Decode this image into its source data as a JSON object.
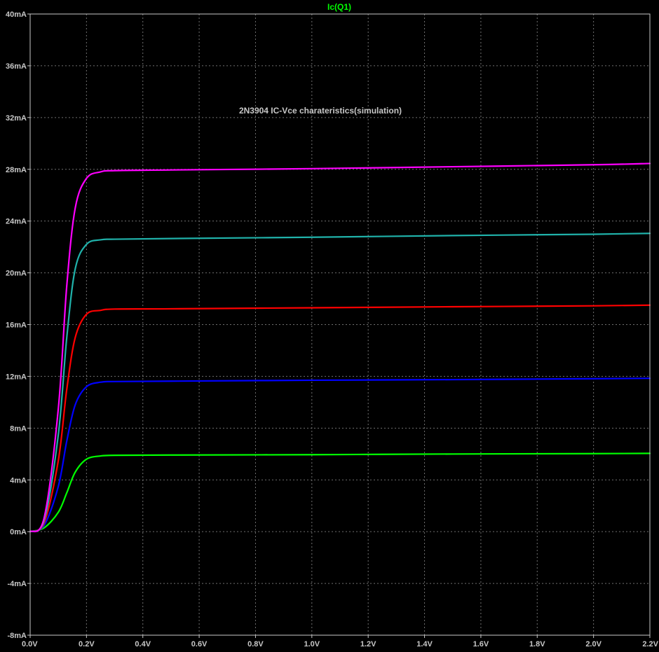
{
  "chart_data": {
    "type": "line",
    "title": "Ic(Q1)",
    "annotation": "2N3904 IC-Vce charateristics(simulation)",
    "xlim": [
      0,
      2.2
    ],
    "ylim": [
      -8,
      40
    ],
    "grid": true,
    "x_ticks": [
      0,
      0.2,
      0.4,
      0.6,
      0.8,
      1.0,
      1.2,
      1.4,
      1.6,
      1.8,
      2.0,
      2.2
    ],
    "x_tick_labels": [
      "0.0V",
      "0.2V",
      "0.4V",
      "0.6V",
      "0.8V",
      "1.0V",
      "1.2V",
      "1.4V",
      "1.6V",
      "1.8V",
      "2.0V",
      "2.2V"
    ],
    "y_ticks": [
      -8,
      -4,
      0,
      4,
      8,
      12,
      16,
      20,
      24,
      28,
      32,
      36,
      40
    ],
    "y_tick_labels": [
      "-8mA",
      "-4mA",
      "0mA",
      "4mA",
      "8mA",
      "12mA",
      "16mA",
      "20mA",
      "24mA",
      "28mA",
      "32mA",
      "36mA",
      "40mA"
    ],
    "colors": {
      "background": "#000000",
      "axis": "#c8c8c8",
      "grid": "#707070",
      "title": "#00ff00"
    },
    "series": [
      {
        "color": "#00ff00",
        "x": [
          0,
          0.05,
          0.1,
          0.13,
          0.16,
          0.2,
          0.25,
          0.3,
          0.5,
          1.0,
          1.5,
          2.0,
          2.2
        ],
        "values": [
          0,
          0.3,
          1.5,
          3.0,
          4.6,
          5.6,
          5.85,
          5.9,
          5.92,
          5.95,
          6.0,
          6.03,
          6.05
        ]
      },
      {
        "color": "#0000ff",
        "x": [
          0,
          0.05,
          0.1,
          0.13,
          0.16,
          0.2,
          0.25,
          0.3,
          0.5,
          1.0,
          1.5,
          2.0,
          2.2
        ],
        "values": [
          0,
          0.5,
          3.5,
          7.0,
          9.8,
          11.2,
          11.55,
          11.6,
          11.63,
          11.7,
          11.75,
          11.82,
          11.85
        ]
      },
      {
        "color": "#ff0000",
        "x": [
          0,
          0.05,
          0.1,
          0.13,
          0.16,
          0.2,
          0.25,
          0.3,
          0.5,
          1.0,
          1.5,
          2.0,
          2.2
        ],
        "values": [
          0,
          0.7,
          5.5,
          11.0,
          15.0,
          16.8,
          17.1,
          17.2,
          17.22,
          17.3,
          17.38,
          17.45,
          17.5
        ]
      },
      {
        "color": "#20b2aa",
        "x": [
          0,
          0.05,
          0.1,
          0.13,
          0.16,
          0.2,
          0.25,
          0.3,
          0.5,
          1.0,
          1.5,
          2.0,
          2.2
        ],
        "values": [
          0,
          0.9,
          7.5,
          15.0,
          20.3,
          22.2,
          22.55,
          22.6,
          22.65,
          22.75,
          22.88,
          22.98,
          23.05
        ]
      },
      {
        "color": "#ff00ff",
        "x": [
          0,
          0.05,
          0.1,
          0.13,
          0.16,
          0.2,
          0.25,
          0.3,
          0.5,
          1.0,
          1.5,
          2.0,
          2.2
        ],
        "values": [
          0,
          1.1,
          9.5,
          19.0,
          25.0,
          27.3,
          27.8,
          27.9,
          27.95,
          28.05,
          28.2,
          28.35,
          28.45
        ]
      }
    ]
  }
}
